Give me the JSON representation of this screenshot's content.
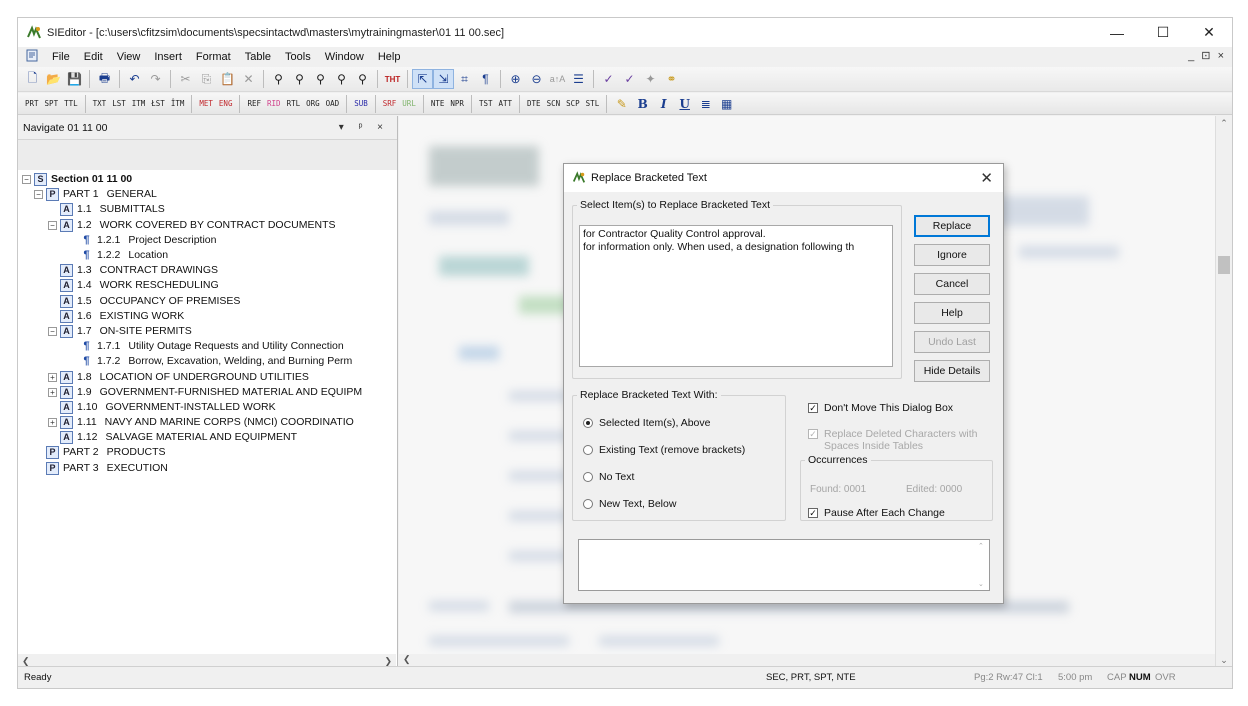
{
  "window": {
    "title": "SIEditor - [c:\\users\\cfitzsim\\documents\\specsintactwd\\masters\\mytrainingmaster\\01 11 00.sec]",
    "minimize": "—",
    "maximize": "☐",
    "close": "✕",
    "mdi_controls": "_ ⊡ ×"
  },
  "menu": [
    "File",
    "Edit",
    "View",
    "Insert",
    "Format",
    "Table",
    "Tools",
    "Window",
    "Help"
  ],
  "toolbar1": [
    "new-icon",
    "open-icon",
    "save-icon",
    "print-icon",
    "undo-icon",
    "redo-icon",
    "cut-icon",
    "copy-icon",
    "paste-icon",
    "delete-icon",
    "find-icon",
    "find-next-icon",
    "find-replace-icon",
    "find-bracket-icon",
    "find-all-icon",
    "tht-icon",
    "zoom-in-icon",
    "zoom-out-icon",
    "tag-icon",
    "paragraph-icon",
    "zoom-plus-icon",
    "zoom-minus-icon",
    "font-size-icon",
    "list-icon",
    "spell-icon",
    "spell-check-icon",
    "pin-icon",
    "link-icon"
  ],
  "toolbar2": [
    "PRT",
    "SPT",
    "TTL",
    "TXT",
    "LST",
    "ITM",
    "ŁST",
    "ÎTM",
    "MET",
    "ENG",
    "REF",
    "RID",
    "RTL",
    "ORG",
    "OAD",
    "SUB",
    "SRF",
    "URL",
    "NTE",
    "NPR",
    "TST",
    "ATT",
    "DTE",
    "SCN",
    "SCP",
    "STL"
  ],
  "toolbar2_format": {
    "bold": "B",
    "italic": "I",
    "underline": "U"
  },
  "nav": {
    "title": "Navigate 01 11 00",
    "controls": "▾ ᵖ ×",
    "tree": [
      {
        "toggle": "−",
        "icon": "S",
        "num": "",
        "label": "Section 01 11 00",
        "level": 0,
        "bold": true
      },
      {
        "toggle": "−",
        "icon": "P",
        "num": "PART 1",
        "label": "GENERAL",
        "level": 1
      },
      {
        "toggle": "",
        "icon": "A",
        "num": "1.1",
        "label": "SUBMITTALS",
        "level": 2
      },
      {
        "toggle": "−",
        "icon": "A",
        "num": "1.2",
        "label": "WORK COVERED BY CONTRACT DOCUMENTS",
        "level": 2
      },
      {
        "toggle": "",
        "icon": "¶",
        "num": "1.2.1",
        "label": "Project Description",
        "level": 3
      },
      {
        "toggle": "",
        "icon": "¶",
        "num": "1.2.2",
        "label": "Location",
        "level": 3
      },
      {
        "toggle": "",
        "icon": "A",
        "num": "1.3",
        "label": "CONTRACT DRAWINGS",
        "level": 2
      },
      {
        "toggle": "",
        "icon": "A",
        "num": "1.4",
        "label": "WORK RESCHEDULING",
        "level": 2
      },
      {
        "toggle": "",
        "icon": "A",
        "num": "1.5",
        "label": "OCCUPANCY OF PREMISES",
        "level": 2
      },
      {
        "toggle": "",
        "icon": "A",
        "num": "1.6",
        "label": "EXISTING WORK",
        "level": 2
      },
      {
        "toggle": "−",
        "icon": "A",
        "num": "1.7",
        "label": "ON-SITE PERMITS",
        "level": 2
      },
      {
        "toggle": "",
        "icon": "¶",
        "num": "1.7.1",
        "label": "Utility Outage Requests and Utility Connection",
        "level": 3
      },
      {
        "toggle": "",
        "icon": "¶",
        "num": "1.7.2",
        "label": "Borrow, Excavation, Welding, and Burning Perm",
        "level": 3
      },
      {
        "toggle": "+",
        "icon": "A",
        "num": "1.8",
        "label": "LOCATION OF UNDERGROUND UTILITIES",
        "level": 2
      },
      {
        "toggle": "+",
        "icon": "A",
        "num": "1.9",
        "label": "GOVERNMENT-FURNISHED MATERIAL AND EQUIPM",
        "level": 2
      },
      {
        "toggle": "",
        "icon": "A",
        "num": "1.10",
        "label": "GOVERNMENT-INSTALLED WORK",
        "level": 2
      },
      {
        "toggle": "+",
        "icon": "A",
        "num": "1.11",
        "label": "NAVY AND MARINE CORPS (NMCI) COORDINATIO",
        "level": 2
      },
      {
        "toggle": "",
        "icon": "A",
        "num": "1.12",
        "label": "SALVAGE MATERIAL AND EQUIPMENT",
        "level": 2
      },
      {
        "toggle": "",
        "icon": "P",
        "num": "PART 2",
        "label": "PRODUCTS",
        "level": 1
      },
      {
        "toggle": "",
        "icon": "P",
        "num": "PART 3",
        "label": "EXECUTION",
        "level": 1
      }
    ]
  },
  "dialog": {
    "title": "Replace Bracketed Text",
    "close": "✕",
    "select_group_label": "Select Item(s) to Replace Bracketed Text",
    "select_items": [
      "for Contractor Quality Control approval.",
      "for information only.  When used, a designation following th"
    ],
    "buttons": {
      "replace": "Replace",
      "ignore": "Ignore",
      "cancel": "Cancel",
      "help": "Help",
      "undo_last": "Undo Last",
      "hide_details": "Hide Details"
    },
    "replace_with_label": "Replace Bracketed Text With:",
    "replace_options": [
      {
        "label": "Selected Item(s), Above",
        "selected": true
      },
      {
        "label": "Existing Text (remove brackets)",
        "selected": false
      },
      {
        "label": "No Text",
        "selected": false
      },
      {
        "label": "New Text, Below",
        "selected": false
      }
    ],
    "dont_move_label": "Don't Move This Dialog Box",
    "replace_deleted_label": "Replace Deleted Characters with Spaces Inside Tables",
    "occurrences_label": "Occurrences",
    "found": "Found: 0001",
    "edited": "Edited: 0000",
    "pause_label": "Pause After Each Change",
    "new_text_value": ""
  },
  "status": {
    "ready": "Ready",
    "tags": "SEC, PRT, SPT, NTE",
    "position": "Pg:2 Rw:47 Cl:1",
    "time": "5:00 pm",
    "cap": "CAP",
    "num": "NUM",
    "ovr": "OVR"
  }
}
